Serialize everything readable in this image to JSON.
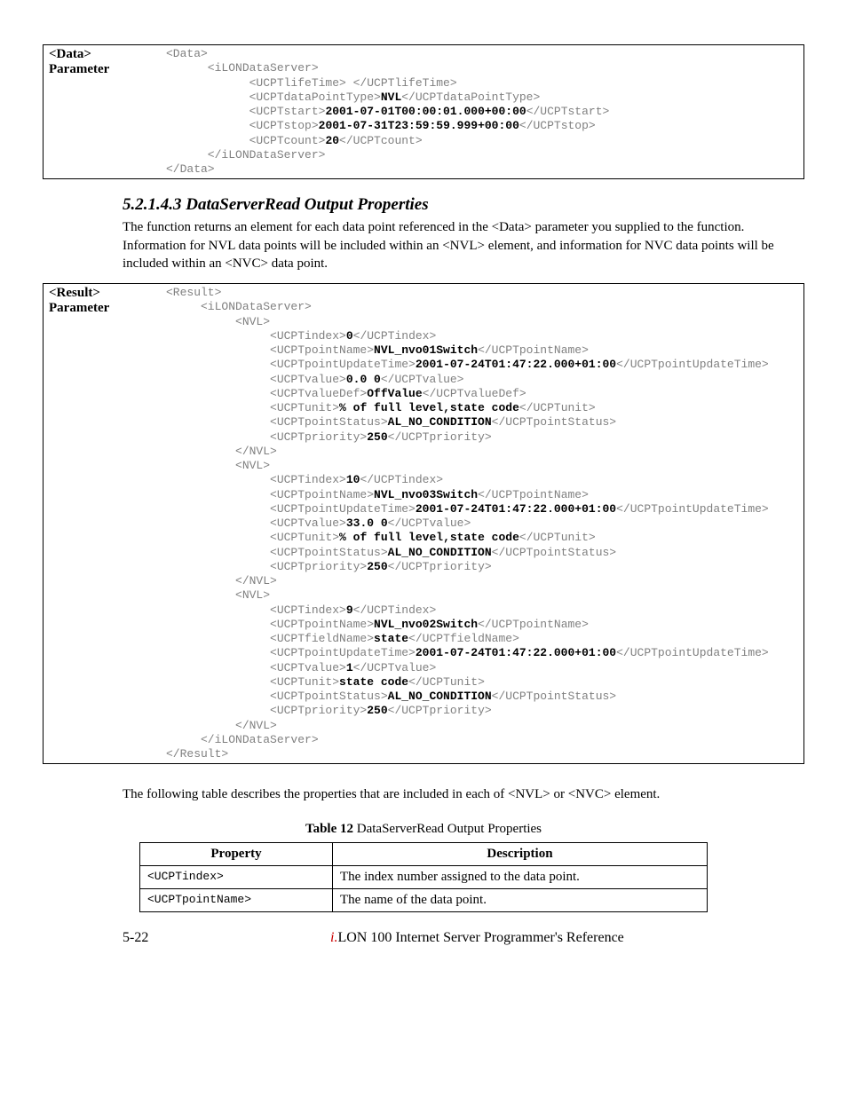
{
  "block1": {
    "label_line1": "<Data>",
    "label_line2": "Parameter",
    "code_html": "&lt;Data&gt;\n      &lt;iLONDataServer&gt;\n            &lt;UCPTlifeTime&gt; &lt;/UCPTlifeTime&gt;\n            &lt;UCPTdataPointType&gt;<b>NVL</b>&lt;/UCPTdataPointType&gt;\n            &lt;UCPTstart&gt;<b>2001-07-01T00:00:01.000+00:00</b>&lt;/UCPTstart&gt;\n            &lt;UCPTstop&gt;<b>2001-07-31T23:59:59.999+00:00</b>&lt;/UCPTstop&gt;\n            &lt;UCPTcount&gt;<b>20</b>&lt;/UCPTcount&gt;\n      &lt;/iLONDataServer&gt;\n&lt;/Data&gt;"
  },
  "section": {
    "heading": "5.2.1.4.3  DataServerRead Output Properties",
    "para1": "The function returns an element for each data point referenced in the <Data> parameter you supplied to the function. Information for NVL data points will be included within an <NVL> element, and information for NVC data points will be included within an <NVC> data point."
  },
  "block2": {
    "label_line1": "<Result>",
    "label_line2": "Parameter",
    "code_html": "&lt;Result&gt;\n     &lt;iLONDataServer&gt;\n          &lt;NVL&gt;\n               &lt;UCPTindex&gt;<b>0</b>&lt;/UCPTindex&gt;\n               &lt;UCPTpointName&gt;<b>NVL_nvo01Switch</b>&lt;/UCPTpointName&gt;\n               &lt;UCPTpointUpdateTime&gt;<b>2001-07-24T01:47:22.000+01:00</b>&lt;/UCPTpointUpdateTime&gt;\n               &lt;UCPTvalue&gt;<b>0.0 0</b>&lt;/UCPTvalue&gt;\n               &lt;UCPTvalueDef&gt;<b>OffValue</b>&lt;/UCPTvalueDef&gt;\n               &lt;UCPTunit&gt;<b>% of full level,state code</b>&lt;/UCPTunit&gt;\n               &lt;UCPTpointStatus&gt;<b>AL_NO_CONDITION</b>&lt;/UCPTpointStatus&gt;\n               &lt;UCPTpriority&gt;<b>250</b>&lt;/UCPTpriority&gt;\n          &lt;/NVL&gt;\n          &lt;NVL&gt;\n               &lt;UCPTindex&gt;<b>10</b>&lt;/UCPTindex&gt;\n               &lt;UCPTpointName&gt;<b>NVL_nvo03Switch</b>&lt;/UCPTpointName&gt;\n               &lt;UCPTpointUpdateTime&gt;<b>2001-07-24T01:47:22.000+01:00</b>&lt;/UCPTpointUpdateTime&gt;\n               &lt;UCPTvalue&gt;<b>33.0 0</b>&lt;/UCPTvalue&gt;\n               &lt;UCPTunit&gt;<b>% of full level,state code</b>&lt;/UCPTunit&gt;\n               &lt;UCPTpointStatus&gt;<b>AL_NO_CONDITION</b>&lt;/UCPTpointStatus&gt;\n               &lt;UCPTpriority&gt;<b>250</b>&lt;/UCPTpriority&gt;\n          &lt;/NVL&gt;\n          &lt;NVL&gt;\n               &lt;UCPTindex&gt;<b>9</b>&lt;/UCPTindex&gt;\n               &lt;UCPTpointName&gt;<b>NVL_nvo02Switch</b>&lt;/UCPTpointName&gt;\n               &lt;UCPTfieldName&gt;<b>state</b>&lt;/UCPTfieldName&gt;\n               &lt;UCPTpointUpdateTime&gt;<b>2001-07-24T01:47:22.000+01:00</b>&lt;/UCPTpointUpdateTime&gt;\n               &lt;UCPTvalue&gt;<b>1</b>&lt;/UCPTvalue&gt;\n               &lt;UCPTunit&gt;<b>state code</b>&lt;/UCPTunit&gt;\n               &lt;UCPTpointStatus&gt;<b>AL_NO_CONDITION</b>&lt;/UCPTpointStatus&gt;\n               &lt;UCPTpriority&gt;<b>250</b>&lt;/UCPTpriority&gt;\n          &lt;/NVL&gt;\n     &lt;/iLONDataServer&gt;\n&lt;/Result&gt;"
  },
  "para2": "The following table describes the properties that are included in each of <NVL> or <NVC> element.",
  "table_caption_bold": "Table 12",
  "table_caption_rest": "   DataServerRead Output Properties",
  "table": {
    "h1": "Property",
    "h2": "Description",
    "rows": [
      {
        "p": "<UCPTindex>",
        "d": "The index number assigned to the data point."
      },
      {
        "p": "<UCPTpointName>",
        "d": "The name of the data point."
      }
    ]
  },
  "footer": {
    "page": "5-22",
    "title_prefix": "i.",
    "title_rest": "LON 100 Internet Server Programmer's Reference"
  }
}
